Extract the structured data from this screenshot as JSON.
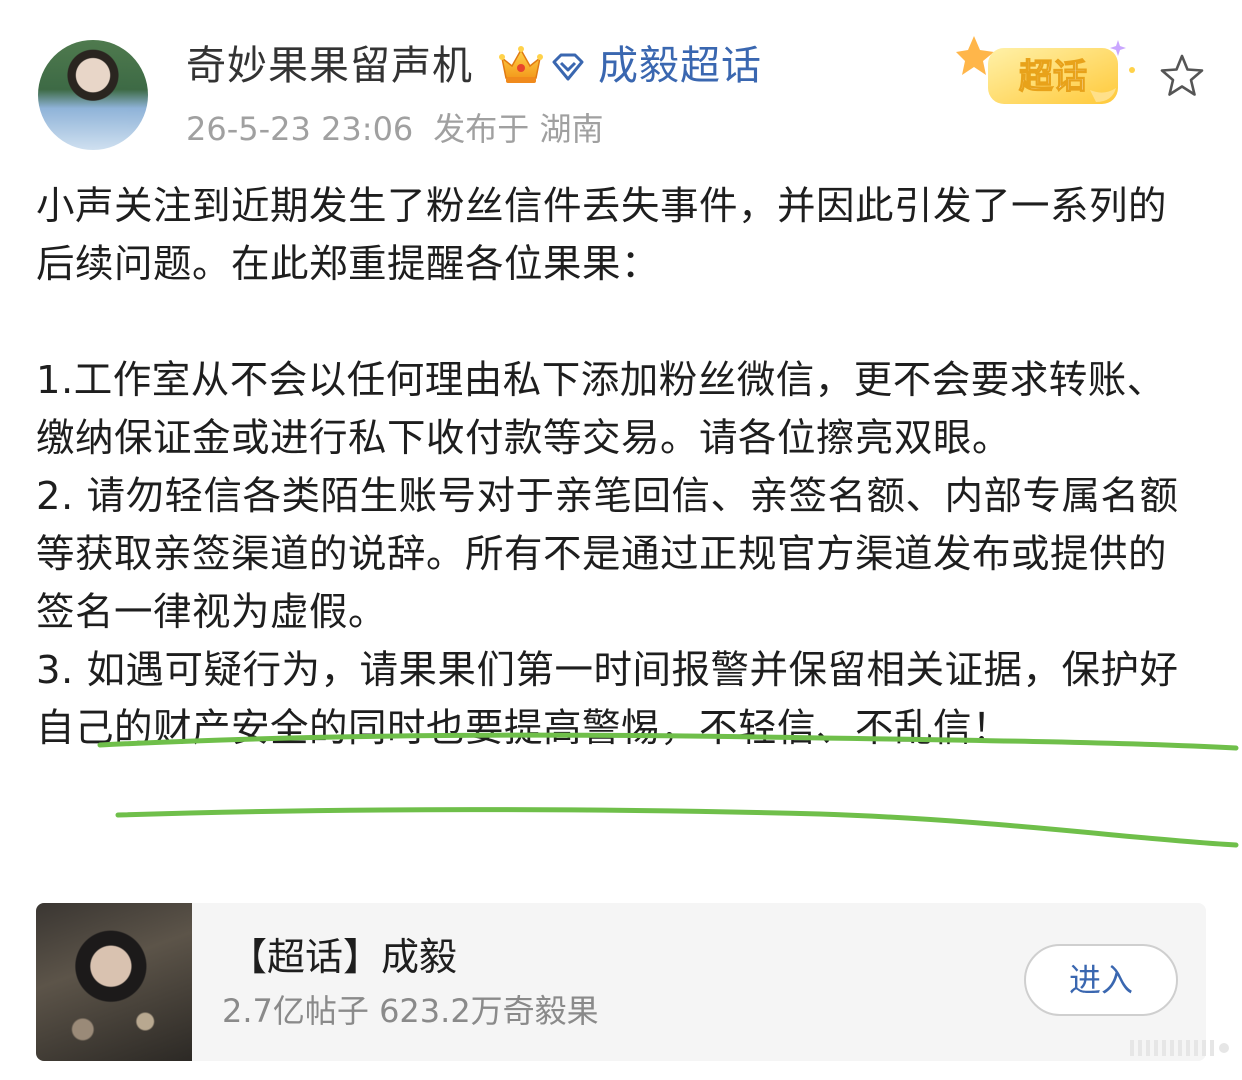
{
  "post": {
    "username": "奇妙果果留声机",
    "topic_link": "成毅超话",
    "timestamp": "26-5-23 23:06",
    "location": "发布于 湖南",
    "badge_text": "超话",
    "paragraphs": [
      "小声关注到近期发生了粉丝信件丢失事件，并因此引发了一系列的后续问题。在此郑重提醒各位果果：",
      "1.工作室从不会以任何理由私下添加粉丝微信，更不会要求转账、缴纳保证金或进行私下收付款等交易。请各位擦亮双眼。",
      "2. 请勿轻信各类陌生账号对于亲笔回信、亲签名额、内部专属名额等获取亲签渠道的说辞。所有不是通过正规官方渠道发布或提供的签名一律视为虚假。",
      "3. 如遇可疑行为，请果果们第一时间报警并保留相关证据，保护好自己的财产安全的同时也要提高警惕，不轻信、不乱信！"
    ]
  },
  "card": {
    "title": "【超话】成毅",
    "stats": "2.7亿帖子 623.2万奇毅果",
    "enter_label": "进入"
  },
  "icons": {
    "crown": "crown-icon",
    "diamond": "diamond-icon",
    "star": "star-icon"
  },
  "colors": {
    "link_blue": "#3a67b0",
    "highlight_green": "#6fbf4a",
    "badge_yellow": "#ffd84a"
  }
}
